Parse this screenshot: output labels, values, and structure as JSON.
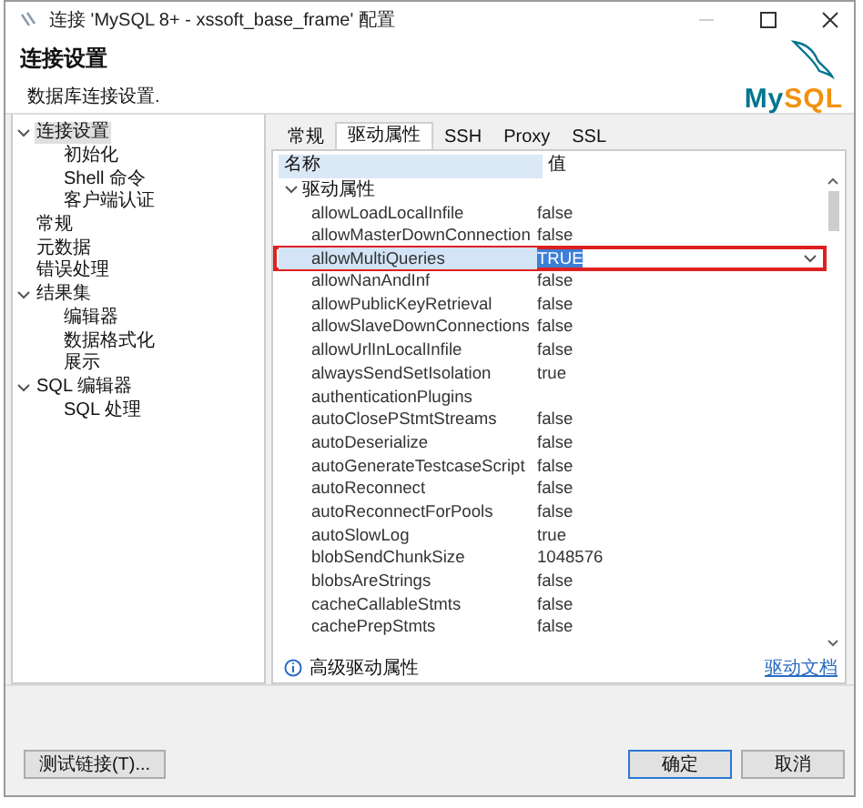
{
  "window": {
    "title": "连接 'MySQL 8+ - xssoft_base_frame' 配置"
  },
  "header": {
    "title": "连接设置",
    "subtitle": "数据库连接设置.",
    "logo": [
      {
        "text": "My",
        "color": "#00758f"
      },
      {
        "text": "SQL",
        "color": "#f29111"
      }
    ]
  },
  "tree": [
    {
      "label": "连接设置",
      "selected": true,
      "expanded": true,
      "children": [
        {
          "label": "初始化",
          "selected": false
        },
        {
          "label": "Shell 命令",
          "selected": false
        },
        {
          "label": "客户端认证",
          "selected": false
        }
      ]
    },
    {
      "label": "常规",
      "selected": false
    },
    {
      "label": "元数据",
      "selected": false
    },
    {
      "label": "错误处理",
      "selected": false
    },
    {
      "label": "结果集",
      "selected": false,
      "expanded": true,
      "children": [
        {
          "label": "编辑器",
          "selected": false
        },
        {
          "label": "数据格式化",
          "selected": false
        },
        {
          "label": "展示",
          "selected": false
        }
      ]
    },
    {
      "label": "SQL 编辑器",
      "selected": false,
      "expanded": true,
      "children": [
        {
          "label": "SQL 处理",
          "selected": false
        }
      ]
    }
  ],
  "tabs": [
    {
      "label": "常规",
      "selected": false
    },
    {
      "label": "驱动属性",
      "selected": true
    },
    {
      "label": "SSH",
      "selected": false
    },
    {
      "label": "Proxy",
      "selected": false
    },
    {
      "label": "SSL",
      "selected": false
    }
  ],
  "table": {
    "columns": [
      "名称",
      "值"
    ],
    "group": {
      "label": "驱动属性",
      "expanded": true
    },
    "rows": [
      {
        "name": "allowLoadLocalInfile",
        "value": "false",
        "selected": false
      },
      {
        "name": "allowMasterDownConnection",
        "value": "false",
        "selected": false
      },
      {
        "name": "allowMultiQueries",
        "value": "TRUE",
        "selected": true
      },
      {
        "name": "allowNanAndInf",
        "value": "false",
        "selected": false
      },
      {
        "name": "allowPublicKeyRetrieval",
        "value": "false",
        "selected": false
      },
      {
        "name": "allowSlaveDownConnections",
        "value": "false",
        "selected": false
      },
      {
        "name": "allowUrlInLocalInfile",
        "value": "false",
        "selected": false
      },
      {
        "name": "alwaysSendSetIsolation",
        "value": "true",
        "selected": false
      },
      {
        "name": "authenticationPlugins",
        "selected": false
      },
      {
        "name": "autoClosePStmtStreams",
        "value": "false",
        "selected": false
      },
      {
        "name": "autoDeserialize",
        "value": "false",
        "selected": false
      },
      {
        "name": "autoGenerateTestcaseScript",
        "value": "false",
        "selected": false
      },
      {
        "name": "autoReconnect",
        "value": "false",
        "selected": false
      },
      {
        "name": "autoReconnectForPools",
        "value": "false",
        "selected": false
      },
      {
        "name": "autoSlowLog",
        "value": "true",
        "selected": false
      },
      {
        "name": "blobSendChunkSize",
        "value": "1048576",
        "selected": false
      },
      {
        "name": "blobsAreStrings",
        "value": "false",
        "selected": false
      },
      {
        "name": "cacheCallableStmts",
        "value": "false",
        "selected": false
      },
      {
        "name": "cachePrepStmts",
        "value": "false",
        "selected": false
      }
    ]
  },
  "note": "高级驱动属性",
  "doc_link": "驱动文档",
  "buttons": [
    {
      "label": "测试链接(T)...",
      "default": false,
      "kind": "left"
    },
    {
      "label": "确定",
      "default": true,
      "kind": "right"
    },
    {
      "label": "取消",
      "default": false,
      "kind": "right"
    }
  ]
}
